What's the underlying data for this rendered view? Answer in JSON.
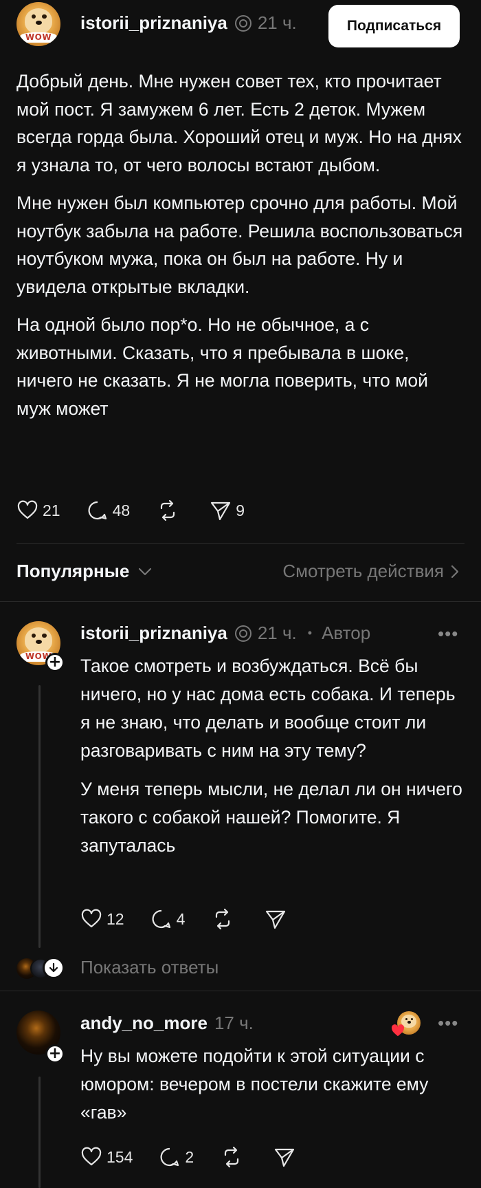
{
  "post": {
    "username": "istorii_priznaniya",
    "time": "21 ч.",
    "follow_label": "Подписаться",
    "paragraphs": [
      "Добрый день. Мне нужен совет тех, кто прочитает мой пост. Я замужем 6 лет. Есть 2 деток. Мужем всегда горда была. Хороший отец и муж. Но на днях я узнала то, от чего волосы встают дыбом.",
      "Мне нужен был компьютер срочно для работы. Мой ноутбук забыла на работе. Решила воспользоваться ноутбуком мужа, пока он был на работе. Ну и увидела открытые вкладки.",
      "На одной было пор*о. Но не обычное, а с животными. Сказать, что я пребывала в шоке, ничего не сказать. Я не могла поверить, что мой муж может"
    ],
    "likes": "21",
    "comments": "48",
    "shares": "9"
  },
  "sort": {
    "label": "Популярные",
    "activity_link": "Смотреть действия"
  },
  "replies": [
    {
      "username": "istorii_priznaniya",
      "time": "21 ч.",
      "separator": "•",
      "author_tag": "Автор",
      "more": "•••",
      "paragraphs": [
        "Такое смотреть и возбуждаться. Всё бы ничего, но у нас дома есть собака. И теперь я не знаю, что делать и вообще стоит ли разговаривать с ним на эту тему?",
        "У меня теперь мысли, не делал ли он ничего такого с собакой нашей? Помогите. Я запуталась"
      ],
      "likes": "12",
      "comments": "4",
      "show_replies": "Показать ответы"
    },
    {
      "username": "andy_no_more",
      "time": "17 ч.",
      "more": "•••",
      "paragraphs": [
        "Ну вы можете подойти к этой ситуации с юмором: вечером в постели скажите ему «гав»"
      ],
      "likes": "154",
      "comments": "2"
    }
  ],
  "avatar_text": "WOW",
  "colors": {
    "background": "#101010",
    "text": "#f3f5f7",
    "muted": "#777777",
    "heart_badge": "#ff3040"
  }
}
